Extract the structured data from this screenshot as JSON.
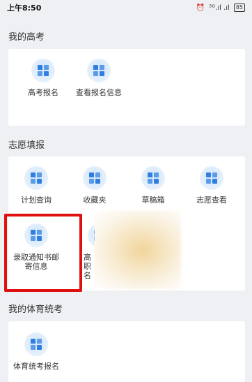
{
  "status_bar": {
    "time": "上午8:50",
    "signal_text": "⁵ᴳ.ıl .ıl",
    "battery": "85"
  },
  "sections": [
    {
      "title": "我的高考",
      "items": [
        {
          "label": "高考报名"
        },
        {
          "label": "查看报名信息"
        }
      ]
    },
    {
      "title": "志愿填报",
      "items": [
        {
          "label": "计划查询"
        },
        {
          "label": "收藏夹"
        },
        {
          "label": "草稿箱"
        },
        {
          "label": "志愿查看"
        },
        {
          "label": "录取通知书邮寄信息"
        },
        {
          "label": "高职名"
        }
      ]
    },
    {
      "title": "我的体育统考",
      "items": [
        {
          "label": "体育统考报名"
        }
      ]
    }
  ],
  "colors": {
    "background": "#eef0f3",
    "card": "#ffffff",
    "icon_blue": "#2f7fe0",
    "highlight": "#e01010"
  }
}
